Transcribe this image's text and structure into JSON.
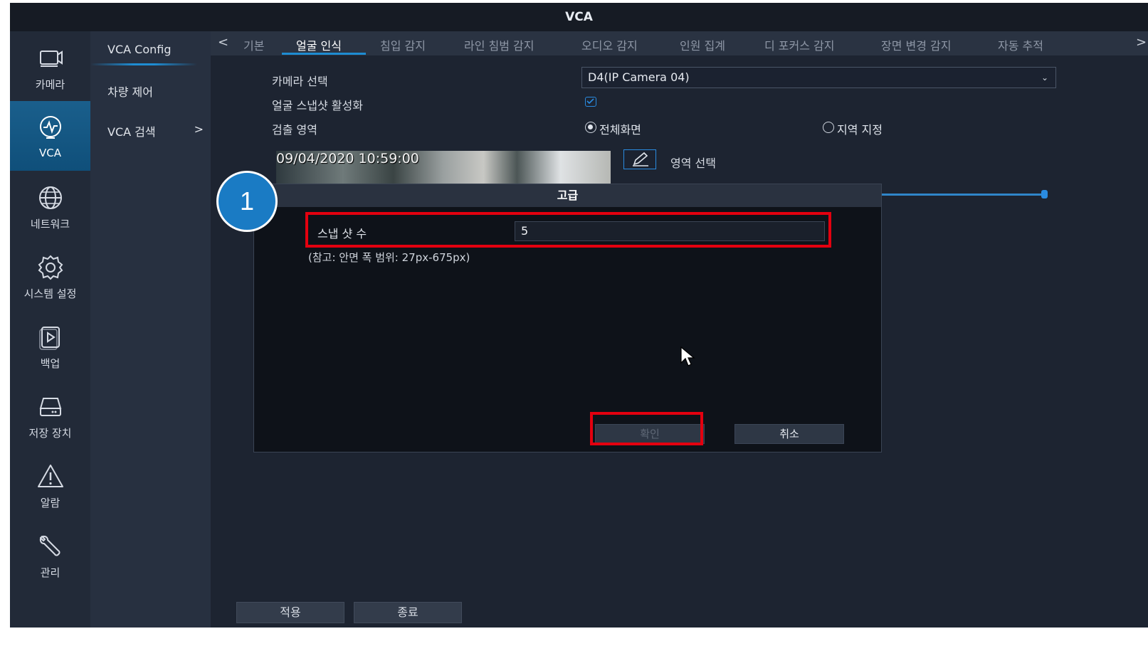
{
  "window": {
    "title": "VCA"
  },
  "nav": {
    "items": [
      {
        "label": "카메라",
        "icon": "camera-icon"
      },
      {
        "label": "VCA",
        "icon": "vca-icon"
      },
      {
        "label": "네트워크",
        "icon": "globe-icon"
      },
      {
        "label": "시스템 설정",
        "icon": "gear-icon"
      },
      {
        "label": "백업",
        "icon": "backup-icon"
      },
      {
        "label": "저장 장치",
        "icon": "storage-icon"
      },
      {
        "label": "알람",
        "icon": "warning-icon"
      },
      {
        "label": "관리",
        "icon": "wrench-icon"
      }
    ],
    "active": "VCA"
  },
  "submenu": {
    "items": [
      {
        "label": "VCA Config"
      },
      {
        "label": "차량 제어"
      },
      {
        "label": "VCA 검색",
        "chevron": ">"
      }
    ]
  },
  "tabs": {
    "prev": "<",
    "next": ">",
    "items": [
      "기본",
      "얼굴 인식",
      "침입 감지",
      "라인 침범 감지",
      "오디오 감지",
      "인원 집계",
      "디 포커스 감지",
      "장면 변경 감지",
      "자동 추적"
    ],
    "active": "얼굴 인식"
  },
  "form": {
    "camera_label": "카메라 선택",
    "camera_value": "D4(IP Camera 04)",
    "snapshot_label": "얼굴 스냅샷 활성화",
    "snapshot_checked": true,
    "area_label": "검출 영역",
    "area_full": "전체화면",
    "area_region": "지역 지정",
    "area_selected": "전체화면",
    "preview_timestamp": "09/04/2020 10:59:00",
    "area_select_label": "영역 선택"
  },
  "footer": {
    "apply": "적용",
    "close": "종료"
  },
  "dialog": {
    "title": "고급",
    "snapshot_count_label": "스냅 샷 수",
    "snapshot_count_value": "5",
    "note": "(참고: 안면 폭 범위: 27px-675px)",
    "ok": "확인",
    "cancel": "취소"
  },
  "annotation": {
    "step": "1",
    "highlight_color": "#e3000f",
    "badge_color": "#1a7bc4"
  }
}
